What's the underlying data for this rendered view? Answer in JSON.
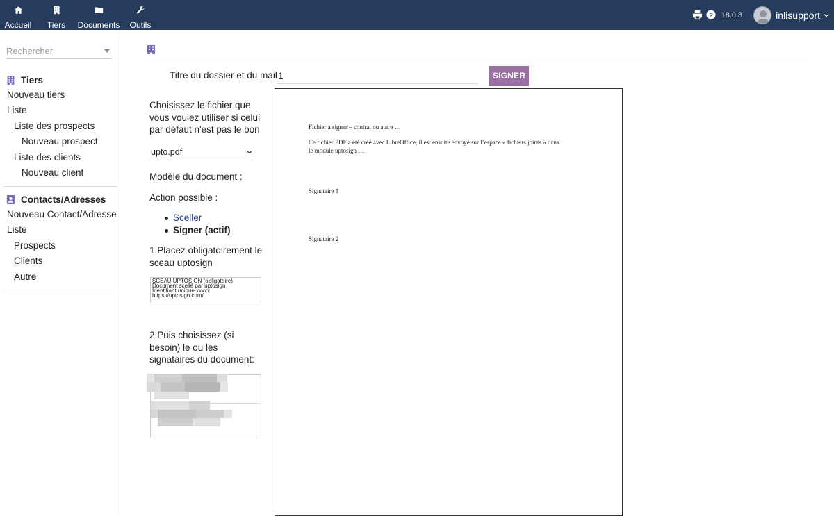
{
  "topnav": {
    "items": [
      {
        "label": "Accueil",
        "icon": "home-icon"
      },
      {
        "label": "Tiers",
        "icon": "building-icon"
      },
      {
        "label": "Documents",
        "icon": "folder-icon"
      },
      {
        "label": "Outils",
        "icon": "wrench-icon"
      }
    ],
    "version": "18.0.8",
    "user": "inlisupport"
  },
  "sidebar": {
    "search_placeholder": "Rechercher",
    "tiers": {
      "title": "Tiers",
      "items": [
        "Nouveau tiers",
        "Liste",
        "Liste des prospects",
        "Nouveau prospect",
        "Liste des clients",
        "Nouveau client"
      ]
    },
    "contacts": {
      "title": "Contacts/Adresses",
      "items": [
        "Nouveau Contact/Adresse",
        "Liste",
        "Prospects",
        "Clients",
        "Autre"
      ]
    }
  },
  "form": {
    "title_label": "Titre du dossier et du mail :",
    "title_value": "1",
    "sign_button": "SIGNER",
    "choose_file_text": "Choisissez le fichier que vous voulez utiliser si celui par défaut n'est pas le bon",
    "file_selected": "upto.pdf",
    "model_label": "Modèle du document :",
    "action_label": "Action possible :",
    "actions": [
      "Sceller",
      "Signer (actif)"
    ],
    "step1": "1.Placez obligatoirement le sceau uptosign",
    "seal_lines": [
      "SCEAU UPTOSIGN (obligatoire)",
      "Document scellé par uptosign",
      "Identifiant unique xxxxx",
      "https://uptosign.com/"
    ],
    "step2": "2.Puis choisissez (si besoin) le ou les signataires du document:"
  },
  "pdf": {
    "line1": "Fichier à signer – contrat ou autre …",
    "line2": "Ce fichier PDF a été créé avec LibreOffice, il est ensuite envoyé sur l’espace « fichiers joints » dans",
    "line3": "le module uptosign …",
    "sig1": "Signataire 1",
    "sig2": "Signataire 2"
  }
}
